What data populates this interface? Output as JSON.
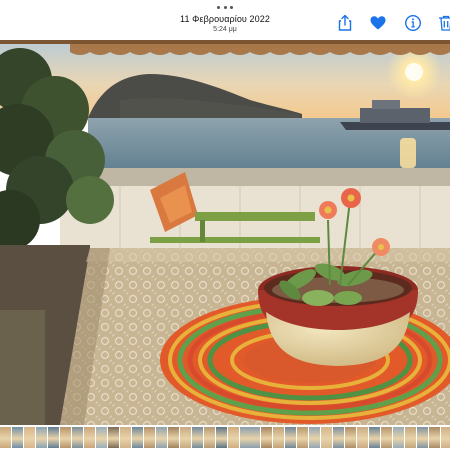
{
  "header": {
    "date": "11 Φεβρουαρίου 2022",
    "time": "5:24 μμ"
  },
  "toolbar": {
    "more_icon": "more-dots-icon",
    "share_icon": "share-icon",
    "favorite_icon": "heart-icon",
    "info_icon": "info-icon",
    "delete_icon": "trash-icon"
  },
  "colors": {
    "accent": "#1a73e8",
    "sunset_sky": "#f2c888",
    "sea": "#6e8b9a",
    "awning": "#a8784a",
    "coral": "#e25a2a"
  },
  "photo": {
    "subject": "sea-view-balcony-sunset"
  },
  "thumbnail_strip": {
    "thumbnail_colors": [
      "#c9a77a",
      "#6f8fa8",
      "#d9b48a",
      "#8aa3b5",
      "#5e7c94",
      "#b89468",
      "#7a8f9c",
      "#caa57b",
      "#9aaebb",
      "#7c6a55",
      "#d0b186",
      "#6d879a",
      "#b3926c",
      "#8da2b1",
      "#a0835f",
      "#c6aa82",
      "#748b9b",
      "#b59a74",
      "#5d7489",
      "#cfae80",
      "#8a9eae",
      "#a58660",
      "#c1a27a",
      "#6f8799",
      "#b8986e",
      "#92a6b4",
      "#d4b78c",
      "#7b8e9d",
      "#ad8d66",
      "#c9ab84",
      "#6a8397",
      "#b5966e",
      "#98abb8",
      "#c3a57c",
      "#7f93a2",
      "#a98a64",
      "#cdb088",
      "#718a9b",
      "#bc9c72",
      "#8ea3b2"
    ],
    "current_index": 20
  }
}
